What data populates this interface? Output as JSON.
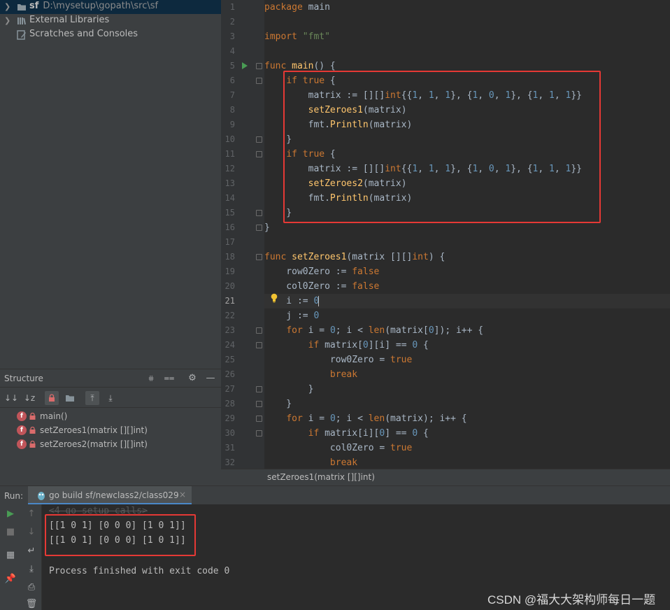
{
  "project": {
    "root_name": "sf",
    "root_path": "D:\\mysetup\\gopath\\src\\sf",
    "external_libraries": "External Libraries",
    "scratches": "Scratches and Consoles"
  },
  "structure": {
    "title": "Structure",
    "items": [
      {
        "name": "main()"
      },
      {
        "name": "setZeroes1(matrix [][]int)"
      },
      {
        "name": "setZeroes2(matrix [][]int)"
      }
    ]
  },
  "editor": {
    "current_line": 21,
    "lines": [
      "1",
      "2",
      "3",
      "4",
      "5",
      "6",
      "7",
      "8",
      "9",
      "10",
      "11",
      "12",
      "13",
      "14",
      "15",
      "16",
      "17",
      "18",
      "19",
      "20",
      "21",
      "22",
      "23",
      "24",
      "25",
      "26",
      "27",
      "28",
      "29",
      "30",
      "31",
      "32"
    ],
    "breadcrumb": "setZeroes1(matrix [][]int)"
  },
  "run": {
    "label": "Run:",
    "tab_title": "go build sf/newclass2/class029",
    "tab_close": "×",
    "console": {
      "setup_line": "<4 go setup calls>",
      "output": [
        "[[1 0 1] [0 0 0] [1 0 1]]",
        "[[1 0 1] [0 0 0] [1 0 1]]"
      ],
      "exit_message": "Process finished with exit code 0"
    }
  },
  "watermark": "CSDN @福大大架构师每日一题",
  "colors": {
    "highlight_box": "#e53935",
    "editor_bg": "#2b2b2b",
    "panel_bg": "#3c3f41",
    "keyword": "#cc7832",
    "function": "#ffc66d",
    "string": "#6a8759",
    "number": "#6897bb"
  }
}
